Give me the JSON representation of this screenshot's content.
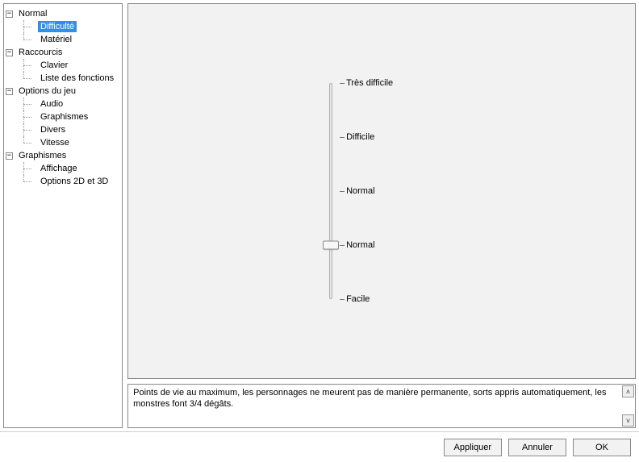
{
  "tree": {
    "normal": {
      "label": "Normal",
      "children": {
        "difficulte": {
          "label": "Difficulté",
          "selected": true
        },
        "materiel": {
          "label": "Matériel"
        }
      }
    },
    "raccourcis": {
      "label": "Raccourcis",
      "children": {
        "clavier": {
          "label": "Clavier"
        },
        "liste_fonctions": {
          "label": "Liste des fonctions"
        }
      }
    },
    "options_jeu": {
      "label": "Options du jeu",
      "children": {
        "audio": {
          "label": "Audio"
        },
        "graphismes": {
          "label": "Graphismes"
        },
        "divers": {
          "label": "Divers"
        },
        "vitesse": {
          "label": "Vitesse"
        }
      }
    },
    "graphismes": {
      "label": "Graphismes",
      "children": {
        "affichage": {
          "label": "Affichage"
        },
        "options_2d3d": {
          "label": "Options 2D et 3D"
        }
      }
    }
  },
  "slider": {
    "levels": [
      "Très difficile",
      "Difficile",
      "Normal",
      "Normal",
      "Facile"
    ],
    "value_index": 3
  },
  "description": "Points de vie au maximum, les personnages ne meurent pas de manière permanente, sorts appris automatiquement, les monstres font 3/4 dégâts.",
  "buttons": {
    "apply": "Appliquer",
    "cancel": "Annuler",
    "ok": "OK"
  },
  "icons": {
    "minus": "−",
    "up": "˄",
    "down": "˅"
  }
}
